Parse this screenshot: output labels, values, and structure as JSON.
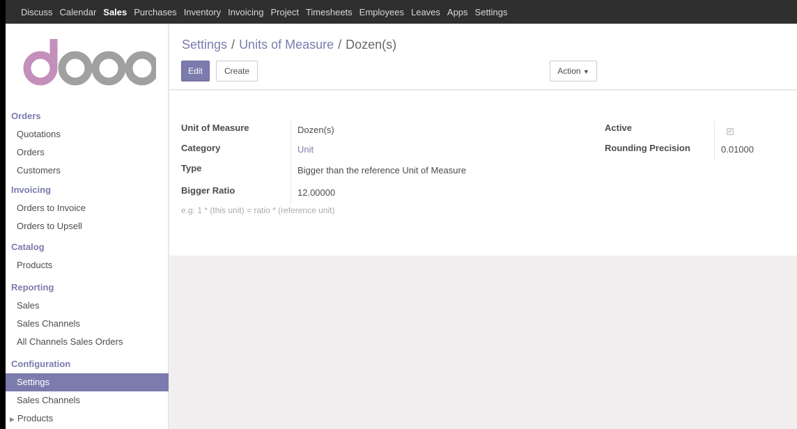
{
  "topbar": {
    "menu": [
      "Discuss",
      "Calendar",
      "Sales",
      "Purchases",
      "Inventory",
      "Invoicing",
      "Project",
      "Timesheets",
      "Employees",
      "Leaves",
      "Apps",
      "Settings"
    ],
    "active": "Sales"
  },
  "logo": {
    "text": "odoo"
  },
  "sidebar": {
    "orders": {
      "title": "Orders",
      "items": [
        "Quotations",
        "Orders",
        "Customers"
      ]
    },
    "invoicing": {
      "title": "Invoicing",
      "items": [
        "Orders to Invoice",
        "Orders to Upsell"
      ]
    },
    "catalog": {
      "title": "Catalog",
      "items": [
        "Products"
      ]
    },
    "reporting": {
      "title": "Reporting",
      "items": [
        "Sales",
        "Sales Channels",
        "All Channels Sales Orders"
      ]
    },
    "configuration": {
      "title": "Configuration",
      "items": [
        "Settings",
        "Sales Channels",
        "Products"
      ],
      "active": "Settings"
    }
  },
  "breadcrumb": {
    "root": "Settings",
    "parent": "Units of Measure",
    "current": "Dozen(s)",
    "separator": "/"
  },
  "buttons": {
    "edit": "Edit",
    "create": "Create",
    "action": "Action"
  },
  "form": {
    "uom_label": "Unit of Measure",
    "uom_value": "Dozen(s)",
    "category_label": "Category",
    "category_value": "Unit",
    "type_label": "Type",
    "type_value": "Bigger than the reference Unit of Measure",
    "ratio_label": "Bigger Ratio",
    "ratio_value": "12.00000",
    "ratio_help": "e.g: 1 * (this unit) = ratio * (reference unit)",
    "active_label": "Active",
    "active_checked": true,
    "rounding_label": "Rounding Precision",
    "rounding_value": "0.01000"
  },
  "colors": {
    "accent": "#7c7bad",
    "topbar": "#2f2f2f",
    "background": "#f0eeee"
  }
}
